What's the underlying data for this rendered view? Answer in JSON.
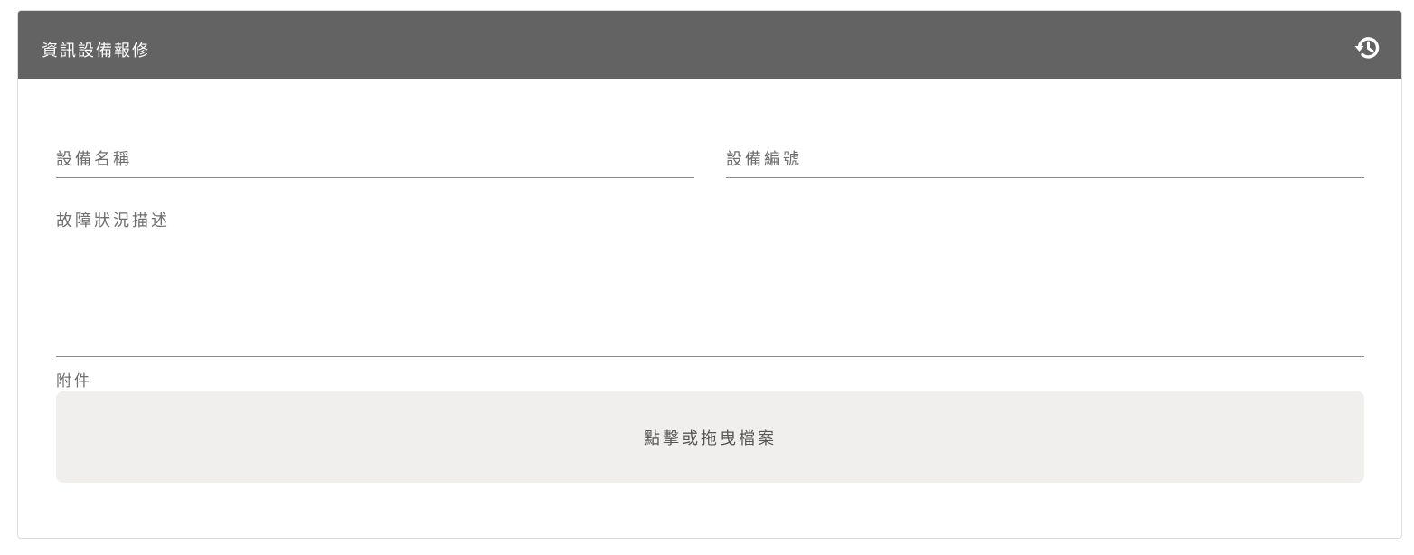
{
  "header": {
    "title": "資訊設備報修",
    "history_icon": "history-icon",
    "background_color": "#636363"
  },
  "form": {
    "equipment_name": {
      "value": "",
      "placeholder": "設備名稱"
    },
    "equipment_code": {
      "value": "",
      "placeholder": "設備編號"
    },
    "fault_description": {
      "value": "",
      "placeholder": "故障狀況描述"
    },
    "attachment": {
      "label": "附件",
      "dropzone_text": "點擊或拖曳檔案"
    }
  },
  "colors": {
    "dropzone_bg": "#f0efed",
    "underline": "#8a8a8a"
  }
}
